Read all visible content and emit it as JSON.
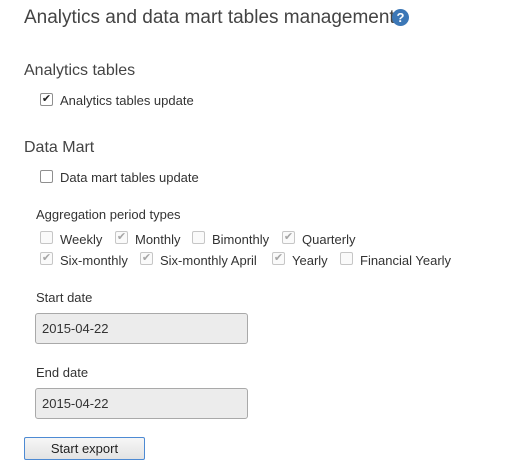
{
  "page": {
    "title": "Analytics and data mart tables management",
    "help_icon": "?"
  },
  "analytics": {
    "section_title": "Analytics tables",
    "update_label": "Analytics tables update",
    "update_checked": true
  },
  "datamart": {
    "section_title": "Data Mart",
    "update_label": "Data mart tables update",
    "update_checked": false,
    "aggregation_title": "Aggregation period types",
    "periods": [
      {
        "label": "Weekly",
        "checked": false
      },
      {
        "label": "Monthly",
        "checked": true
      },
      {
        "label": "Bimonthly",
        "checked": false
      },
      {
        "label": "Quarterly",
        "checked": true
      },
      {
        "label": "Six-monthly",
        "checked": true
      },
      {
        "label": "Six-monthly April",
        "checked": true
      },
      {
        "label": "Yearly",
        "checked": true
      },
      {
        "label": "Financial Yearly",
        "checked": false
      }
    ]
  },
  "dates": {
    "start_label": "Start date",
    "start_value": "2015-04-22",
    "end_label": "End date",
    "end_value": "2015-04-22"
  },
  "actions": {
    "export_label": "Start export"
  }
}
